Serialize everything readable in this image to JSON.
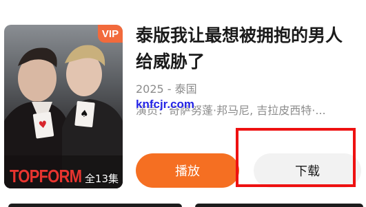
{
  "item": {
    "vip_badge": "VIP",
    "title": "泰版我让最想被拥抱的男人给威胁了",
    "meta": "2025 - 泰国",
    "cast": "演员：奇萨努蓬·邦马尼, 吉拉皮西特·...",
    "episodes": "全13集",
    "poster_logo": "TOPFORM"
  },
  "watermark": "knfcjr.com",
  "actions": {
    "play_label": "播放",
    "download_label": "下载"
  },
  "colors": {
    "accent": "#f56f22",
    "vip": "#f26a3c",
    "highlight": "#ee1111",
    "watermark": "#2424e6"
  }
}
